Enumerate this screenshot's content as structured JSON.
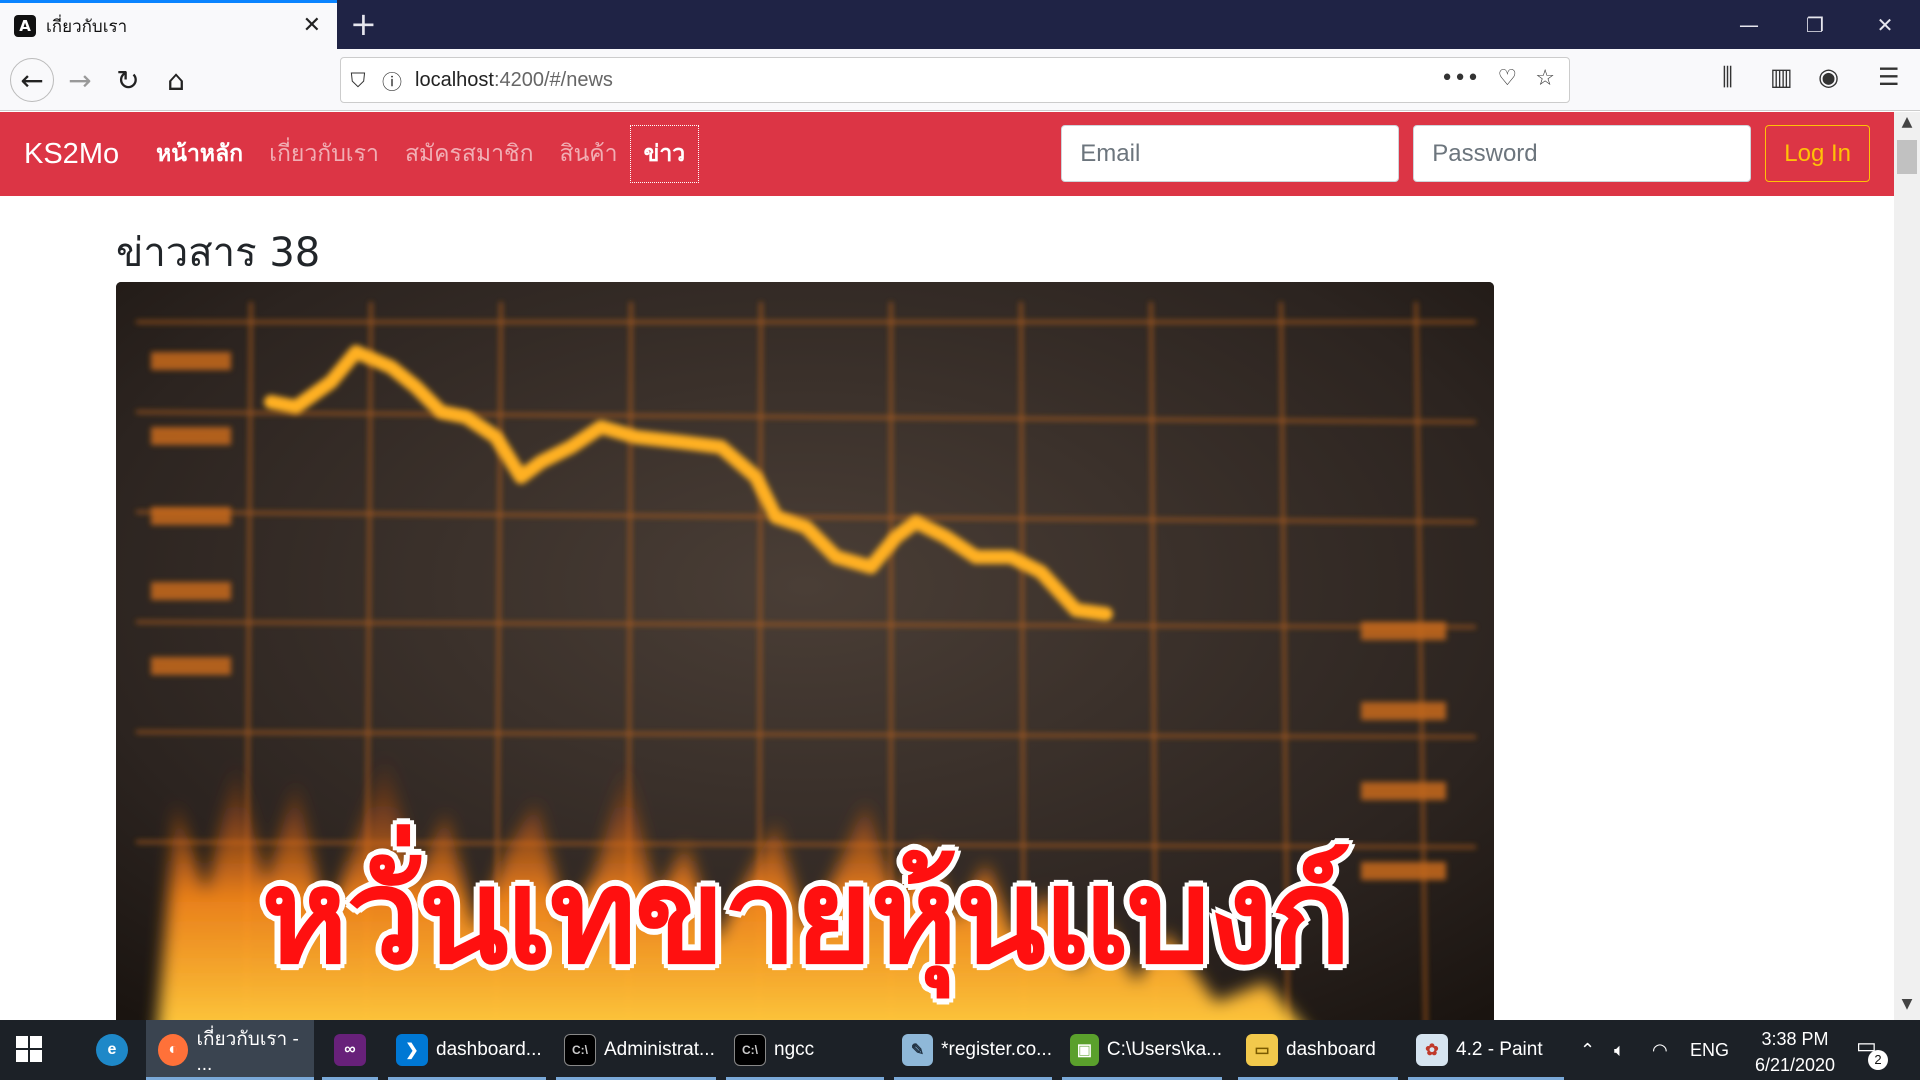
{
  "browser": {
    "tab_title": "เกี่ยวกับเรา",
    "tab_favicon": "A",
    "url_host": "localhost",
    "url_path": ":4200/#/news",
    "icons": [
      "back-arrow-icon",
      "forward-arrow-icon",
      "reload-icon",
      "home-icon",
      "shield-icon",
      "info-icon",
      "more-icon",
      "pocket-icon",
      "star-icon",
      "library-icon",
      "sidebar-icon",
      "account-icon",
      "menu-icon"
    ]
  },
  "site": {
    "brand": "KS2Mo",
    "nav": [
      {
        "label": "หน้าหลัก"
      },
      {
        "label": "เกี่ยวกับเรา"
      },
      {
        "label": "สมัครสมาชิก"
      },
      {
        "label": "สินค้า"
      },
      {
        "label": "ข่าว"
      }
    ],
    "email_placeholder": "Email",
    "password_placeholder": "Password",
    "login_label": "Log In",
    "colors": {
      "navbar": "#dc3545",
      "login": "#ffc107"
    }
  },
  "page": {
    "heading": "ข่าวสาร 38",
    "image_headline": "หวั่นเทขายหุ้นแบงก์"
  },
  "taskbar": {
    "items": [
      {
        "label": "เกี่ยวกับเรา - ..."
      },
      {
        "label": ""
      },
      {
        "label": "dashboard..."
      },
      {
        "label": "Administrat..."
      },
      {
        "label": "ngcc"
      },
      {
        "label": "*register.co..."
      },
      {
        "label": "C:\\Users\\ka..."
      },
      {
        "label": "dashboard"
      },
      {
        "label": "4.2 - Paint"
      }
    ],
    "language": "ENG",
    "time": "3:38 PM",
    "date": "6/21/2020",
    "notification_count": "2"
  }
}
